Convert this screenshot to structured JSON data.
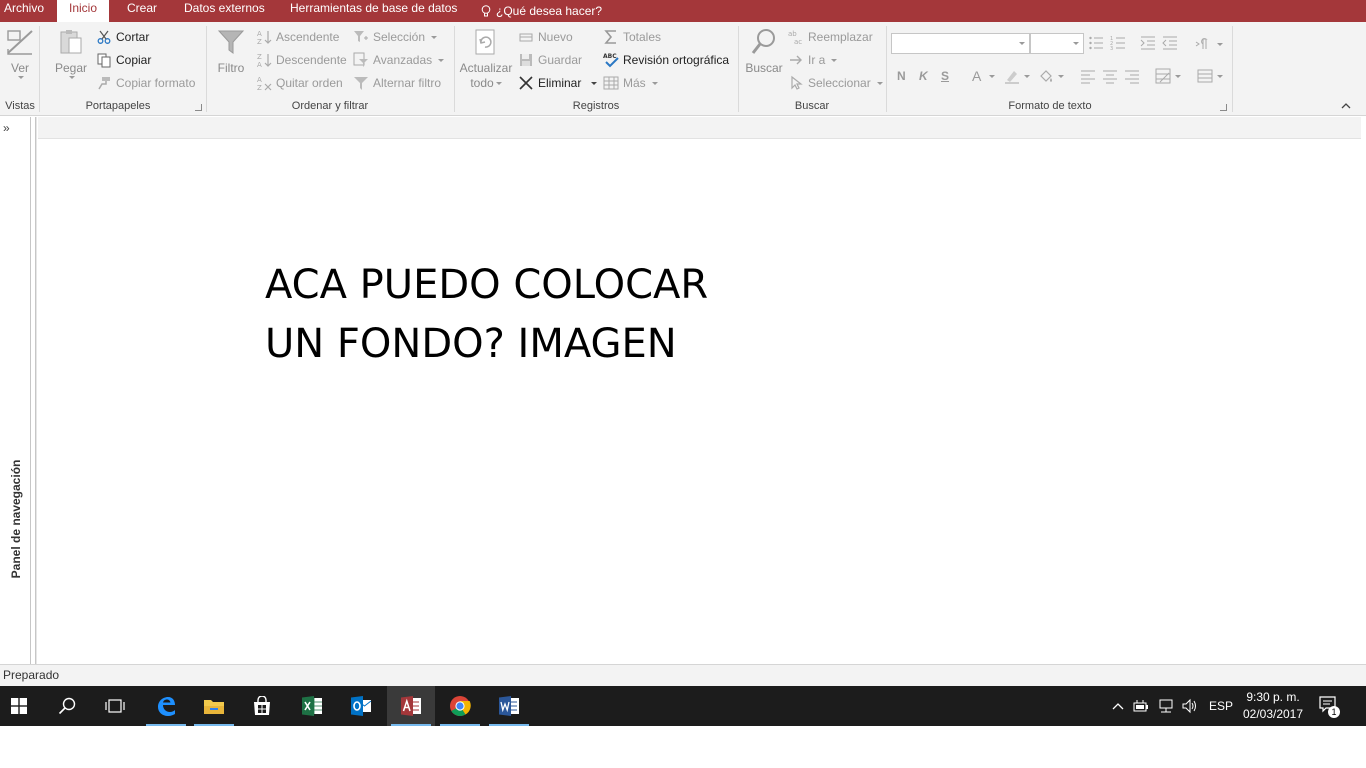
{
  "ribbon_tabs": {
    "file": "Archivo",
    "home": "Inicio",
    "create": "Crear",
    "external_data": "Datos externos",
    "db_tools": "Herramientas de base de datos",
    "tell_me": "¿Qué desea hacer?"
  },
  "groups": {
    "views": {
      "label": "Vistas",
      "view": "Ver"
    },
    "clipboard": {
      "label": "Portapapeles",
      "paste": "Pegar",
      "cut": "Cortar",
      "copy": "Copiar",
      "format_painter": "Copiar formato"
    },
    "sort_filter": {
      "label": "Ordenar y filtrar",
      "filter": "Filtro",
      "ascending": "Ascendente",
      "descending": "Descendente",
      "remove_sort": "Quitar orden",
      "selection": "Selección",
      "advanced": "Avanzadas",
      "toggle_filter": "Alternar filtro"
    },
    "records": {
      "label": "Registros",
      "refresh_line1": "Actualizar",
      "refresh_line2": "todo",
      "new": "Nuevo",
      "save": "Guardar",
      "delete": "Eliminar",
      "totals": "Totales",
      "spelling": "Revisión ortográfica",
      "more": "Más"
    },
    "find": {
      "label": "Buscar",
      "find": "Buscar",
      "replace": "Reemplazar",
      "goto": "Ir a",
      "select": "Seleccionar"
    },
    "text_formatting": {
      "label": "Formato de texto",
      "bold": "N",
      "italic": "K",
      "underline": "S",
      "font_color": "A"
    }
  },
  "nav_pane": {
    "toggle": "»",
    "title": "Panel de navegación"
  },
  "document": {
    "line1": "ACA PUEDO COLOCAR",
    "line2": "UN FONDO? IMAGEN"
  },
  "status": {
    "text": "Preparado"
  },
  "taskbar": {
    "apps": [
      "start-icon",
      "search-icon",
      "task-view-icon",
      "edge-icon",
      "file-explorer-icon",
      "store-icon",
      "excel-icon",
      "outlook-icon",
      "access-icon",
      "chrome-icon",
      "word-icon"
    ],
    "lang": "ESP",
    "time": "9:30 p. m.",
    "date": "02/03/2017",
    "notifications": "1"
  },
  "colors": {
    "access_accent": "#a4373a",
    "ribbon_bg": "#f3f3f3",
    "taskbar_bg": "#1c1c1c"
  }
}
